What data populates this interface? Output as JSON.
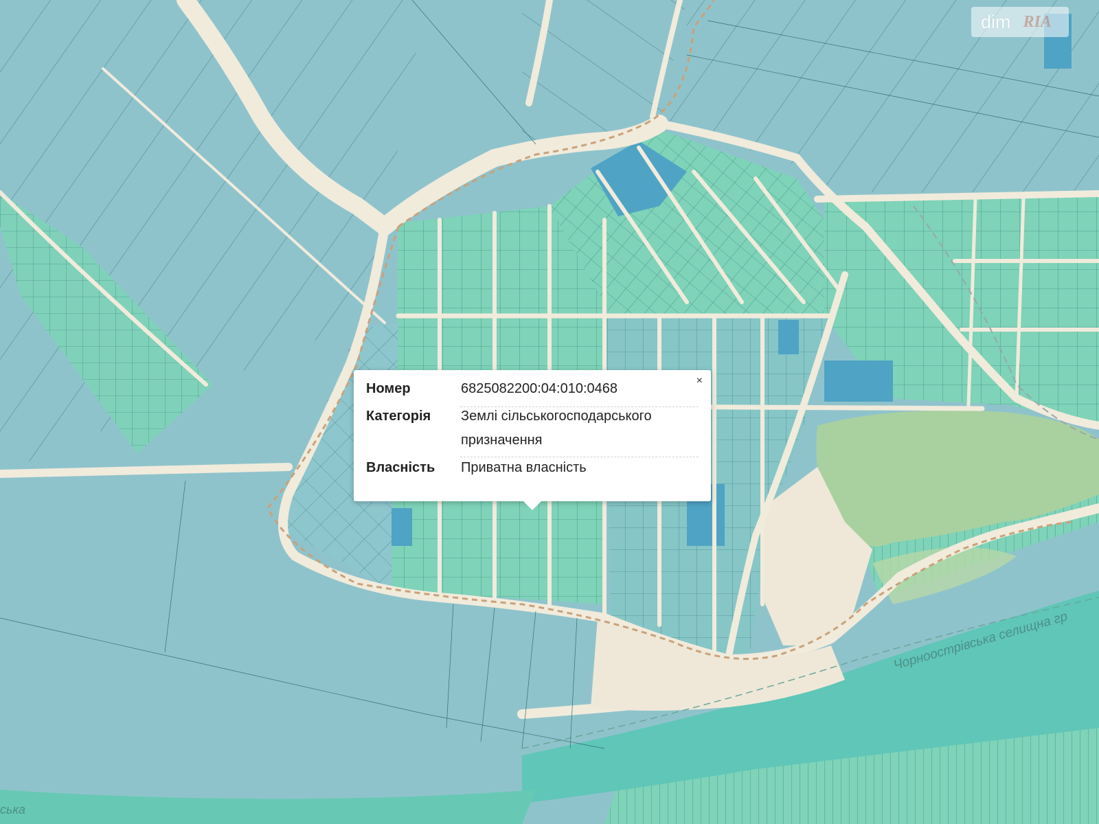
{
  "watermark": {
    "brand": "dim",
    "brand2": "RIA"
  },
  "popup": {
    "close_label": "×",
    "fields": [
      {
        "label": "Номер",
        "value": "6825082200:04:010:0468"
      },
      {
        "label": "Категорія",
        "value": "Землі сільськогосподарського призначення"
      },
      {
        "label": "Власність",
        "value": "Приватна власність"
      }
    ]
  },
  "map_labels": {
    "district_boundary": "Чорноострівська селищна гр",
    "river_edge": "ська"
  },
  "colors": {
    "parcel_blue": "#8fc3cc",
    "parcel_teal": "#7ed3b8",
    "parcel_dark": "#4fa3c4",
    "road": "#f1ebdc",
    "forest": "#a9d1a0",
    "river": "#5fc6b8",
    "boundary_dash": "#c9a27a"
  }
}
